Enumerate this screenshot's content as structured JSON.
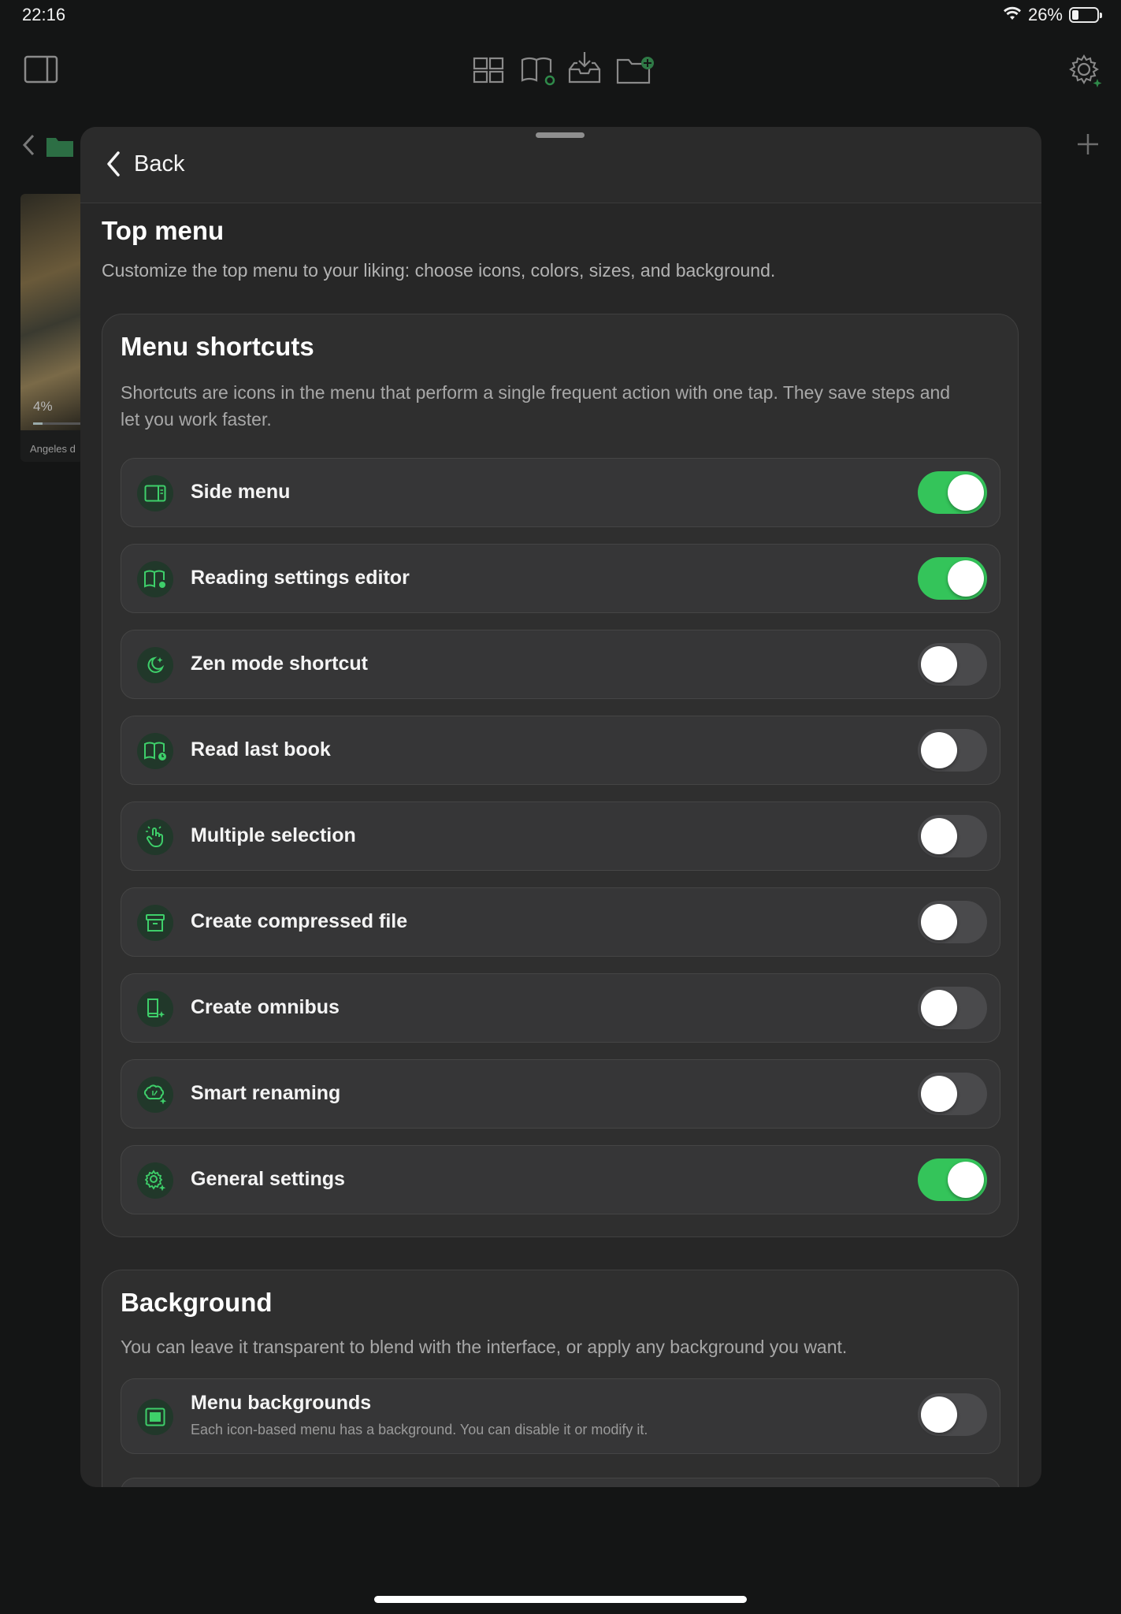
{
  "status_bar": {
    "time": "22:16",
    "battery_percent": "26%",
    "battery_level": 0.26
  },
  "background": {
    "book": {
      "progress": "4%",
      "title": "Angeles d"
    }
  },
  "sheet": {
    "back_label": "Back",
    "title": "Top menu",
    "subtitle": "Customize the top menu to your liking: choose icons, colors, sizes, and background.",
    "shortcuts": {
      "title": "Menu shortcuts",
      "description": "Shortcuts are icons in the menu that perform a single frequent action with one tap. They save steps and let you work faster.",
      "items": [
        {
          "label": "Side menu",
          "icon": "side-menu-icon",
          "on": true
        },
        {
          "label": "Reading settings editor",
          "icon": "book-gear-icon",
          "on": true
        },
        {
          "label": "Zen mode shortcut",
          "icon": "moon-sparkle-icon",
          "on": false
        },
        {
          "label": "Read last book",
          "icon": "book-clock-icon",
          "on": false
        },
        {
          "label": "Multiple selection",
          "icon": "tap-hand-icon",
          "on": false
        },
        {
          "label": "Create compressed file",
          "icon": "archive-box-icon",
          "on": false
        },
        {
          "label": "Create omnibus",
          "icon": "book-sparkle-icon",
          "on": false
        },
        {
          "label": "Smart renaming",
          "icon": "brain-sparkle-icon",
          "on": false
        },
        {
          "label": "General settings",
          "icon": "gear-sparkle-icon",
          "on": true
        }
      ]
    },
    "background_section": {
      "title": "Background",
      "description": "You can leave it transparent to blend with the interface, or apply any background you want.",
      "items": [
        {
          "label": "Menu backgrounds",
          "sublabel": "Each icon-based menu has a background. You can disable it or modify it.",
          "icon": "background-square-icon",
          "on": false
        }
      ]
    }
  },
  "colors": {
    "accent": "#34c45a",
    "icon_green": "#3ecf6a",
    "panel": "#2f2f2f",
    "row": "#363637"
  }
}
